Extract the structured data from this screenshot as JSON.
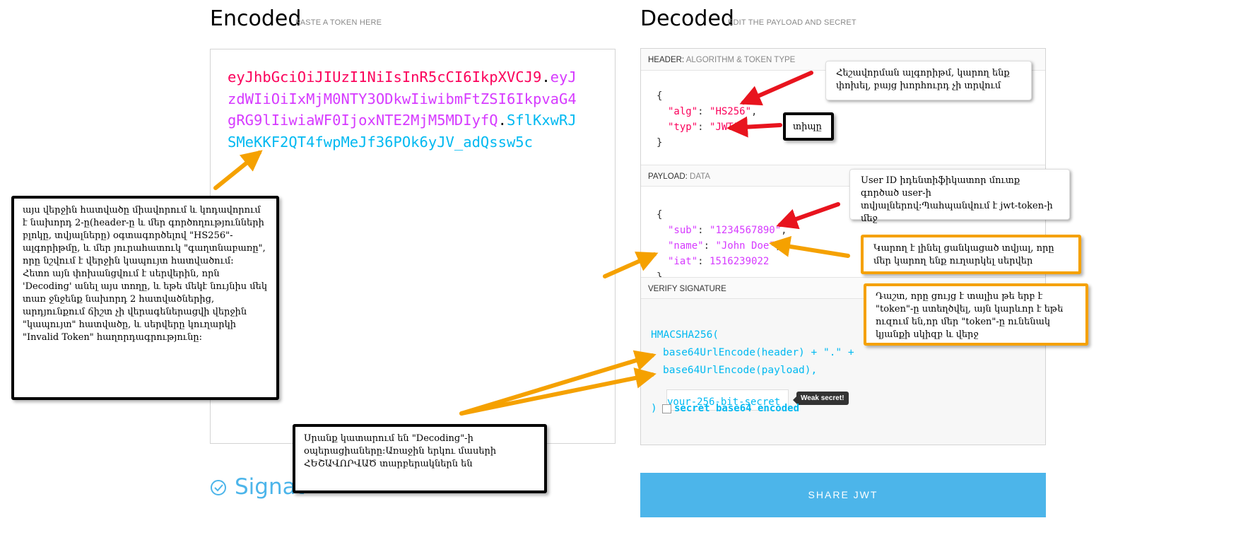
{
  "encoded": {
    "title": "Encoded",
    "subtitle": "PASTE A TOKEN HERE"
  },
  "decoded": {
    "title": "Decoded",
    "subtitle": "EDIT THE PAYLOAD AND SECRET"
  },
  "token": {
    "line1_header": "eyJhbGciOiJIUzI1NiIsInR5cCI6IkpXVCJ9",
    "dot1": ".",
    "line1_payload": "eyJ",
    "line2": "zdWIiOiIxMjM0NTY3ODkwIiwibmFtZSI6IkpvaG4",
    "line3_payload": "gRG9lIiwiaWF0IjoxNTE2MjM5MDIyfQ",
    "dot2": ".",
    "line3_sig": "SflKxwRJ",
    "line4": "SMeKKF2QT4fwpMeJf36POk6yJV_adQssw5c"
  },
  "header_section": {
    "label": "HEADER:",
    "muted": "ALGORITHM & TOKEN TYPE",
    "open": "{",
    "k1": "\"alg\"",
    "v1": "\"HS256\"",
    "k2": "\"typ\"",
    "v2": "\"JWT\"",
    "close": "}"
  },
  "payload_section": {
    "label": "PAYLOAD:",
    "muted": "DATA",
    "open": "{",
    "k1": "\"sub\"",
    "v1": "\"1234567890\"",
    "k2": "\"name\"",
    "v2": "\"John Doe\"",
    "k3": "\"iat\"",
    "v3": "1516239022",
    "close": "}"
  },
  "verify_section": {
    "label": "VERIFY SIGNATURE",
    "fn": "HMACSHA256(",
    "line1": "base64UrlEncode(header) + \".\" +",
    "line2": "base64UrlEncode(payload),",
    "secret_value": "your-256-bit-secret",
    "weak": "Weak secret!",
    "close": ")",
    "checkbox_label": "secret base64 encoded"
  },
  "share_button": "SHARE JWT",
  "signature_partial": "Signat",
  "notes": {
    "alg": "Հեշավորման ալգորիթմ, կարող ենք փոխել, բայց խորհուրդ չի տրվում",
    "typ": "տիպը",
    "sub": "User ID իդենտիֆիկատոր մուտք գործած user-ի տվյալներով:Պահպանվում է jwt-token-ի մեջ",
    "name": "Կարող է լինել ցանկացած տվյալ, որը մեր կարող ենք ուղարկել սերվեր",
    "iat": "Դաշտ, որը ցույց է տալիս թե երբ է \"token\"-ը ստեղծվել, այն կարևոր է եթե ուզում են,որ մեր \"token\"-ը ունենակ կյանքի սկիզբ և վերջ",
    "left": "այս վերջին հատվածը միավորում և կոդավորում է նախորդ 2-ը(header-ը և մեր գործողությունների բլոկը, տվյալները) օգտագործելով \"HS256\"-ալգորիթմը, և մեր յուրահատուկ \"գաղտնաբառը\", որը նշվում է վերջին կապույտ հատվածում:\nՀետո այն փոխանցվում է սերվերին, որն 'Decoding' անել այս տողը, և եթե մեկէ նույնիս մեկ տառ ջնջենք նախորդ 2 հատվածներից, արդյունքում ճիշտ չի վերագեներացվի վերջին \"կապույտ\" հատվածը, և սերվերը կուղարկի \"Invalid Token\" հաղորդագրությունը:",
    "bottom": "Սրանք կատարում են \"Decoding\"-ի օպերացիաները:Առաջին երկու մասերի ՀԵՇԱՎՈՐՎԱԾ տարբերակներն են"
  },
  "colors": {
    "header": "#fb015b",
    "payload": "#d63aff",
    "signature": "#00b9f1",
    "button": "#4cb5ea",
    "arrow_red": "#e8141e",
    "arrow_orange": "#f5a100"
  },
  "icons": [
    "check-circle-icon",
    "arrow-icon"
  ]
}
